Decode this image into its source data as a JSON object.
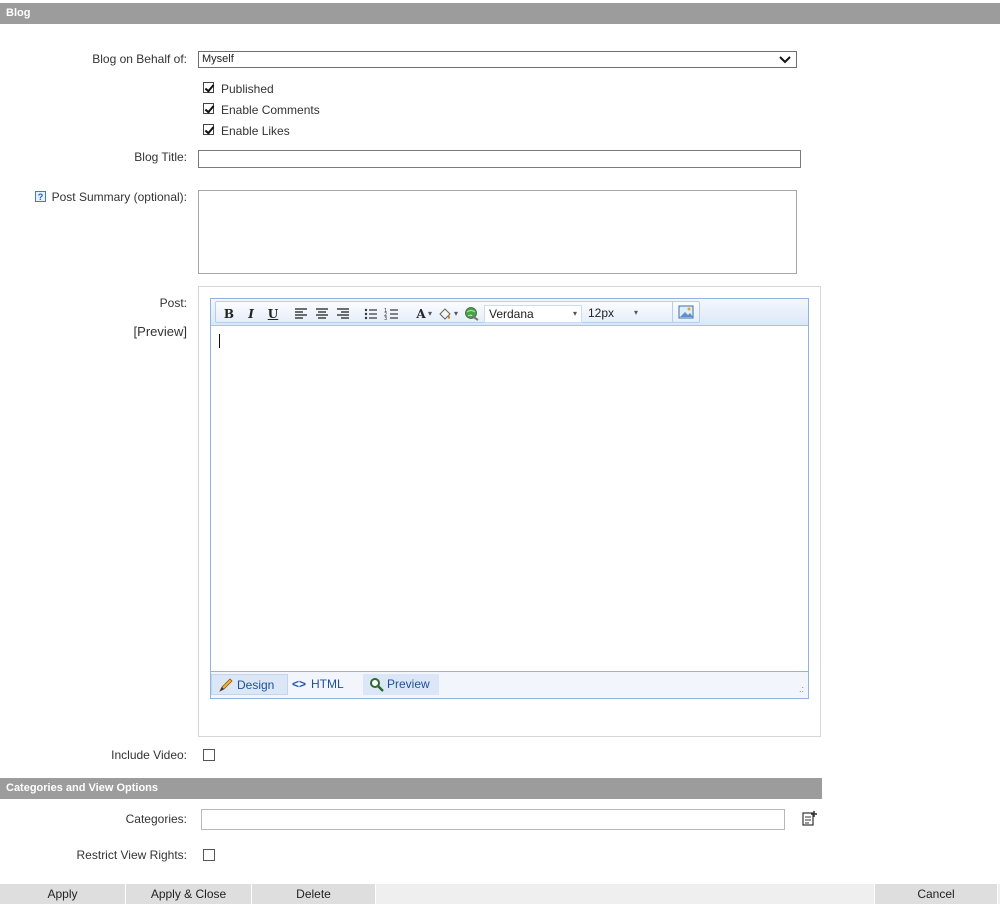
{
  "sections": {
    "blog": "Blog",
    "categories": "Categories and View Options"
  },
  "fields": {
    "behalf_label": "Blog on Behalf of:",
    "behalf_value": "Myself",
    "published": "Published",
    "enable_comments": "Enable Comments",
    "enable_likes": "Enable Likes",
    "title_label": "Blog Title:",
    "title_value": "",
    "summary_label": "Post Summary (optional):",
    "post_label": "Post:",
    "preview_link": "[Preview]",
    "include_video_label": "Include Video:",
    "categories_label": "Categories:",
    "restrict_label": "Restrict View Rights:"
  },
  "editor": {
    "font_name": "Verdana",
    "font_size": "12px",
    "modes": [
      "Design",
      "HTML",
      "Preview"
    ]
  },
  "buttons": {
    "apply": "Apply",
    "apply_close": "Apply & Close",
    "delete": "Delete",
    "cancel": "Cancel"
  },
  "icons": {
    "help": "question-icon",
    "categories_picker": "notepad-add-icon"
  },
  "colors": {
    "section_bar": "#9c9c9c",
    "editor_border": "#8fb4e0",
    "link": "#1f4f99"
  }
}
